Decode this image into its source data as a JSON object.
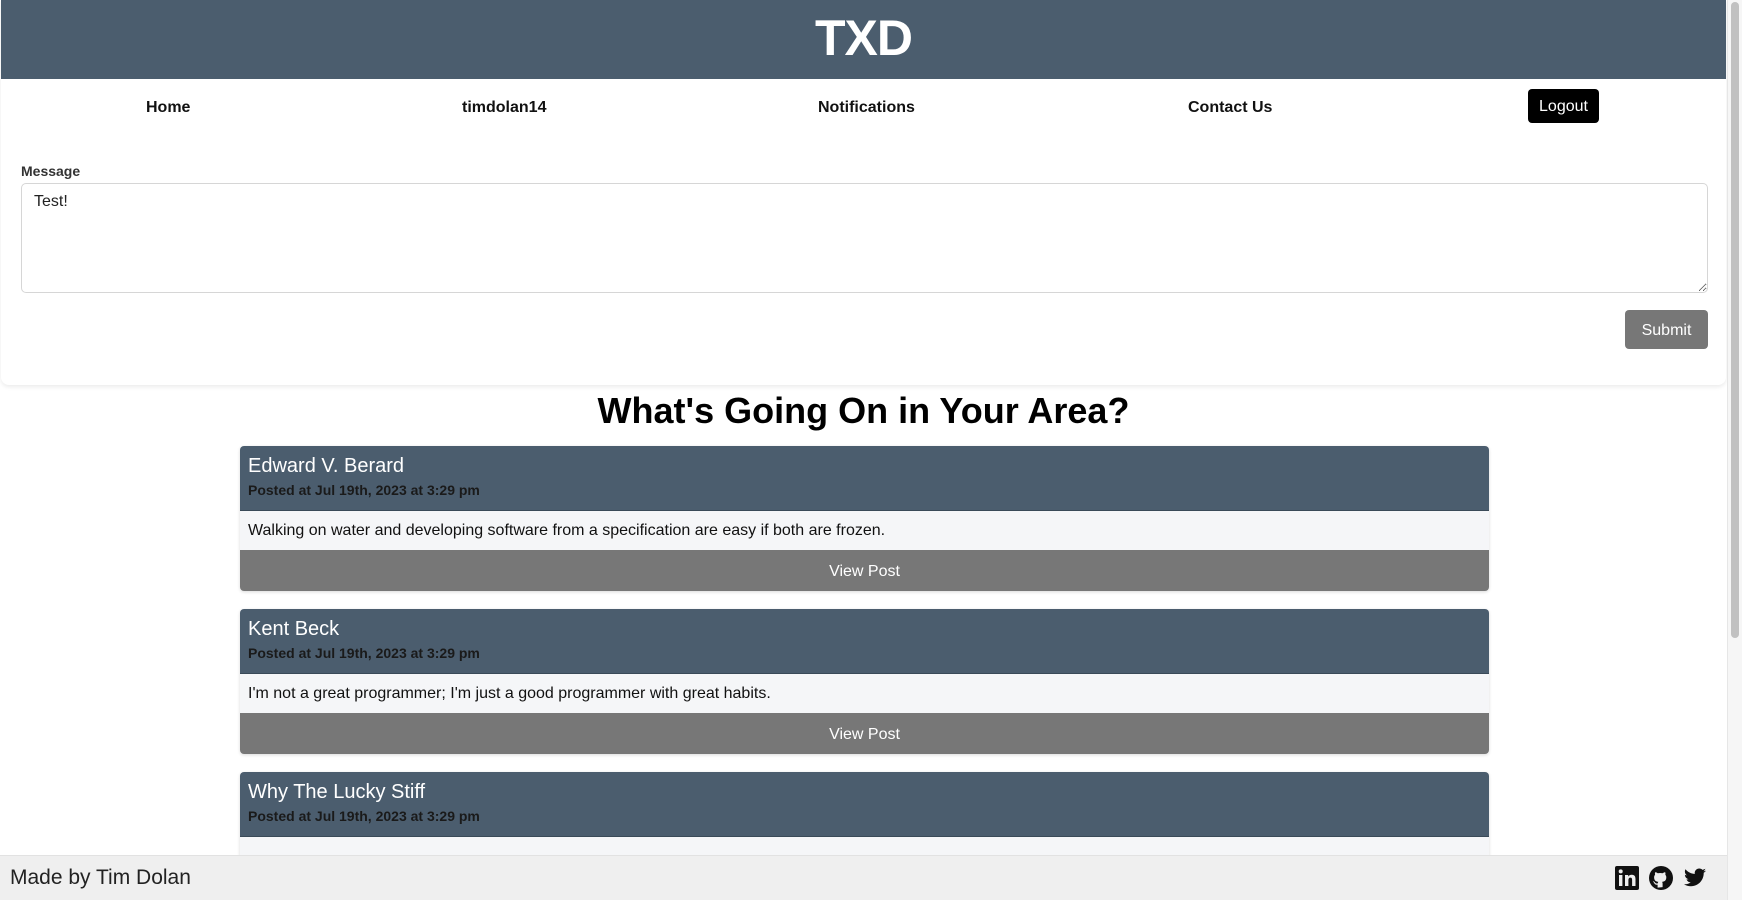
{
  "header": {
    "logo": "TXD"
  },
  "nav": {
    "items": [
      {
        "label": "Home"
      },
      {
        "label": "timdolan14"
      },
      {
        "label": "Notifications"
      },
      {
        "label": "Contact Us"
      }
    ],
    "logout_label": "Logout"
  },
  "compose": {
    "label": "Message",
    "value": "Test!",
    "submit_label": "Submit"
  },
  "feed": {
    "title": "What's Going On in Your Area?",
    "view_label": "View Post",
    "posts": [
      {
        "author": "Edward V. Berard",
        "date": "Posted at Jul 19th, 2023 at 3:29 pm",
        "body": "Walking on water and developing software from a specification are easy if both are frozen."
      },
      {
        "author": "Kent Beck",
        "date": "Posted at Jul 19th, 2023 at 3:29 pm",
        "body": "I'm not a great programmer; I'm just a good programmer with great habits."
      },
      {
        "author": "Why The Lucky Stiff",
        "date": "Posted at Jul 19th, 2023 at 3:29 pm",
        "body": ""
      }
    ]
  },
  "footer": {
    "credit": "Made by Tim Dolan",
    "icons": [
      "linkedin-icon",
      "github-icon",
      "twitter-icon"
    ]
  },
  "colors": {
    "header_bg": "#4b5d6e",
    "button_gray": "#777777",
    "logout_bg": "#000000",
    "post_body_bg": "#f5f6f8",
    "footer_bg": "#efefef"
  }
}
